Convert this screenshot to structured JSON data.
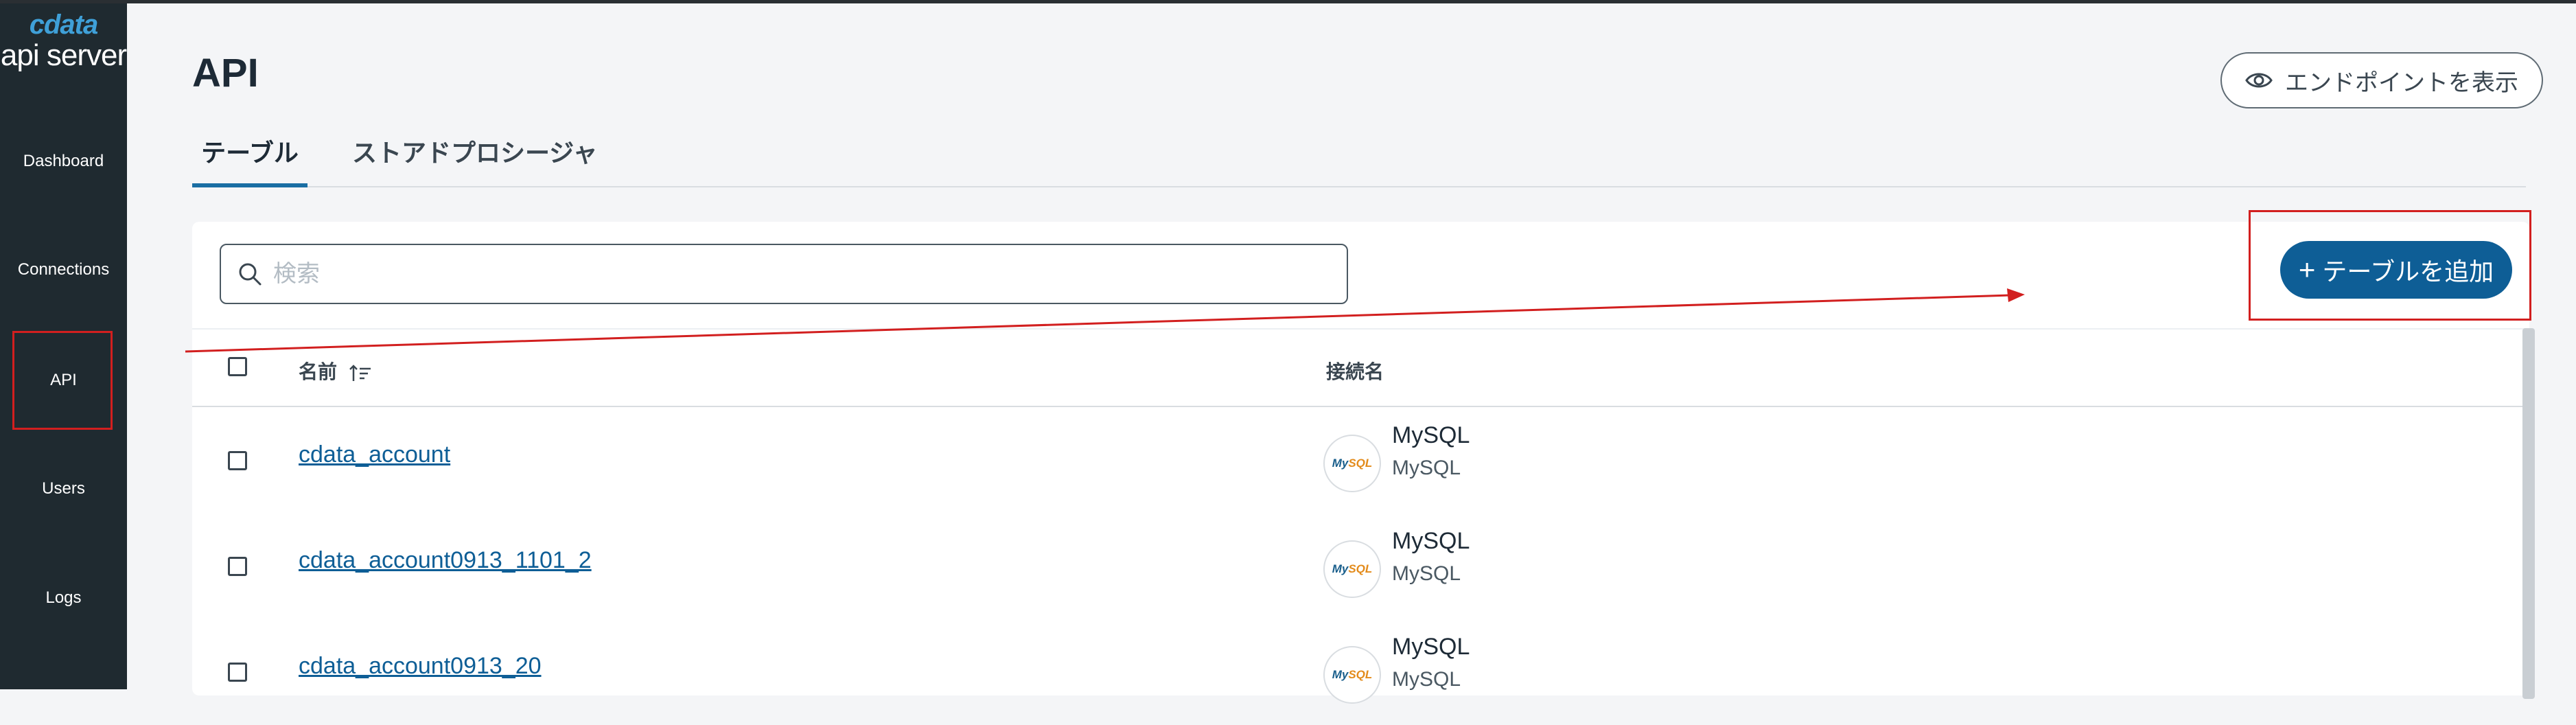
{
  "app": {
    "logo_mark": "cdata",
    "logo_text": "api server"
  },
  "sidebar": {
    "items": [
      {
        "label": "Dashboard"
      },
      {
        "label": "Connections"
      },
      {
        "label": "API"
      },
      {
        "label": "Users"
      },
      {
        "label": "Logs"
      }
    ],
    "active": "API"
  },
  "header": {
    "title": "API",
    "help_icon": "?",
    "endpoint_button": "エンドポイントを表示"
  },
  "tabs": [
    {
      "label": "テーブル",
      "active": true
    },
    {
      "label": "ストアドプロシージャ",
      "active": false
    }
  ],
  "search": {
    "placeholder": "検索",
    "value": ""
  },
  "add_button": {
    "label": "テーブルを追加",
    "plus": "+"
  },
  "table": {
    "columns": [
      {
        "label": "名前"
      },
      {
        "label": "接続名"
      }
    ],
    "rows": [
      {
        "name": "cdata_account",
        "connection": "MySQL",
        "connection_type": "MySQL"
      },
      {
        "name": "cdata_account0913_1101_2",
        "connection": "MySQL",
        "connection_type": "MySQL"
      },
      {
        "name": "cdata_account0913_20",
        "connection": "MySQL",
        "connection_type": "MySQL"
      }
    ]
  },
  "db_logo": {
    "my": "My",
    "sql": "SQL"
  },
  "colors": {
    "sidebar_bg": "#1f2a30",
    "accent": "#0e5e96",
    "annotation": "#d21f1f"
  }
}
